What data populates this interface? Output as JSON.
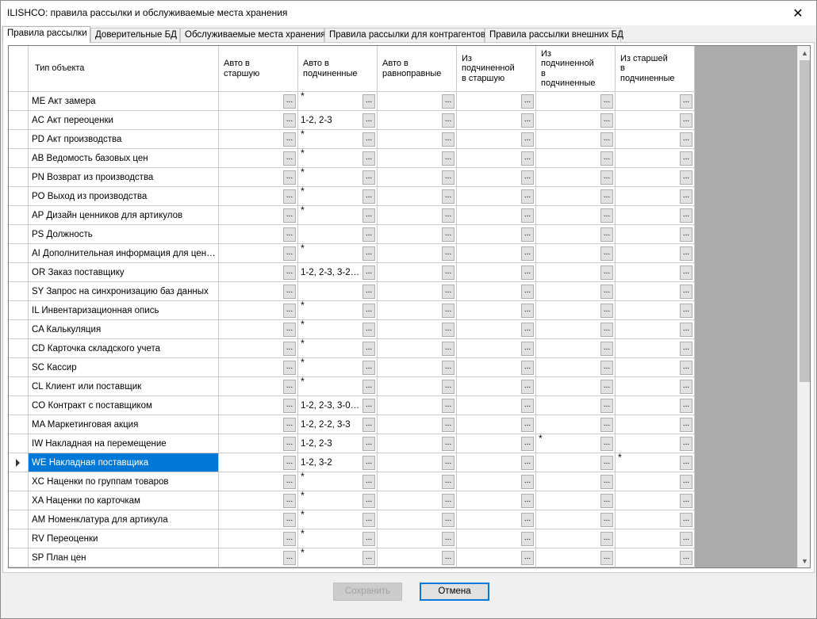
{
  "window": {
    "title": "ILISHCO: правила рассылки и обслуживаемые места хранения",
    "close_glyph": "✕"
  },
  "tabs": [
    {
      "label": "Правила рассылки",
      "active": true
    },
    {
      "label": "Доверительные БД",
      "active": false
    },
    {
      "label": "Обслуживаемые места хранения",
      "active": false
    },
    {
      "label": "Правила рассылки для контрагентов",
      "active": false
    },
    {
      "label": "Правила рассылки внешних БД",
      "active": false
    }
  ],
  "grid": {
    "columns": [
      "Тип объекта",
      "Авто в\nстаршую",
      "Авто в\nподчиненные",
      "Авто в\nравноправные",
      "Из\nподчиненной\nв старшую",
      "Из\nподчиненной\nв\nподчиненные",
      "Из старшей\nв\nподчиненные"
    ],
    "ellipsis_label": "...",
    "selected_index": 19,
    "rows": [
      {
        "name": "ME Акт замера",
        "values": [
          "",
          "*",
          "",
          "",
          "",
          ""
        ]
      },
      {
        "name": "AC Акт переоценки",
        "values": [
          "",
          "1-2, 2-3",
          "",
          "",
          "",
          ""
        ]
      },
      {
        "name": "PD Акт производства",
        "values": [
          "",
          "*",
          "",
          "",
          "",
          ""
        ]
      },
      {
        "name": "AB Ведомость базовых цен",
        "values": [
          "",
          "*",
          "",
          "",
          "",
          ""
        ]
      },
      {
        "name": "PN Возврат из производства",
        "values": [
          "",
          "*",
          "",
          "",
          "",
          ""
        ]
      },
      {
        "name": "PO Выход из производства",
        "values": [
          "",
          "*",
          "",
          "",
          "",
          ""
        ]
      },
      {
        "name": "AP Дизайн ценников для артикулов",
        "values": [
          "",
          "*",
          "",
          "",
          "",
          ""
        ]
      },
      {
        "name": "PS Должность",
        "values": [
          "",
          "",
          "",
          "",
          "",
          ""
        ]
      },
      {
        "name": "AI Дополнительная информация для ценни...",
        "values": [
          "",
          "*",
          "",
          "",
          "",
          ""
        ]
      },
      {
        "name": "OR Заказ поставщику",
        "values": [
          "",
          "1-2, 2-3, 3-2, 2...",
          "",
          "",
          "",
          ""
        ]
      },
      {
        "name": "SY Запрос на синхронизацию баз данных",
        "values": [
          "",
          "",
          "",
          "",
          "",
          ""
        ]
      },
      {
        "name": "IL Инвентаризационная опись",
        "values": [
          "",
          "*",
          "",
          "",
          "",
          ""
        ]
      },
      {
        "name": "CA Калькуляция",
        "values": [
          "",
          "*",
          "",
          "",
          "",
          ""
        ]
      },
      {
        "name": "CD Карточка складского учета",
        "values": [
          "",
          "*",
          "",
          "",
          "",
          ""
        ]
      },
      {
        "name": "SC Кассир",
        "values": [
          "",
          "*",
          "",
          "",
          "",
          ""
        ]
      },
      {
        "name": "CL Клиент или поставщик",
        "values": [
          "",
          "*",
          "",
          "",
          "",
          ""
        ]
      },
      {
        "name": "CO Контракт с поставщиком",
        "values": [
          "",
          "1-2, 2-3, 3-0, 1...",
          "",
          "",
          "",
          ""
        ]
      },
      {
        "name": "MA Маркетинговая акция",
        "values": [
          "",
          "1-2, 2-2, 3-3",
          "",
          "",
          "",
          ""
        ]
      },
      {
        "name": "IW Накладная на перемещение",
        "values": [
          "",
          "1-2, 2-3",
          "",
          "",
          "*",
          ""
        ]
      },
      {
        "name": "WE Накладная поставщика",
        "values": [
          "",
          "1-2, 3-2",
          "",
          "",
          "",
          "*"
        ]
      },
      {
        "name": "XC Наценки по группам товаров",
        "values": [
          "",
          "*",
          "",
          "",
          "",
          ""
        ]
      },
      {
        "name": "XA Наценки по карточкам",
        "values": [
          "",
          "*",
          "",
          "",
          "",
          ""
        ]
      },
      {
        "name": "AM Номенклатура для артикула",
        "values": [
          "",
          "*",
          "",
          "",
          "",
          ""
        ]
      },
      {
        "name": "RV Переоценки",
        "values": [
          "",
          "*",
          "",
          "",
          "",
          ""
        ]
      },
      {
        "name": "SP План цен",
        "values": [
          "",
          "*",
          "",
          "",
          "",
          ""
        ]
      }
    ]
  },
  "scrollbar": {
    "up_glyph": "▲",
    "down_glyph": "▼"
  },
  "buttons": {
    "save_label": "Сохранить",
    "cancel_label": "Отмена"
  }
}
